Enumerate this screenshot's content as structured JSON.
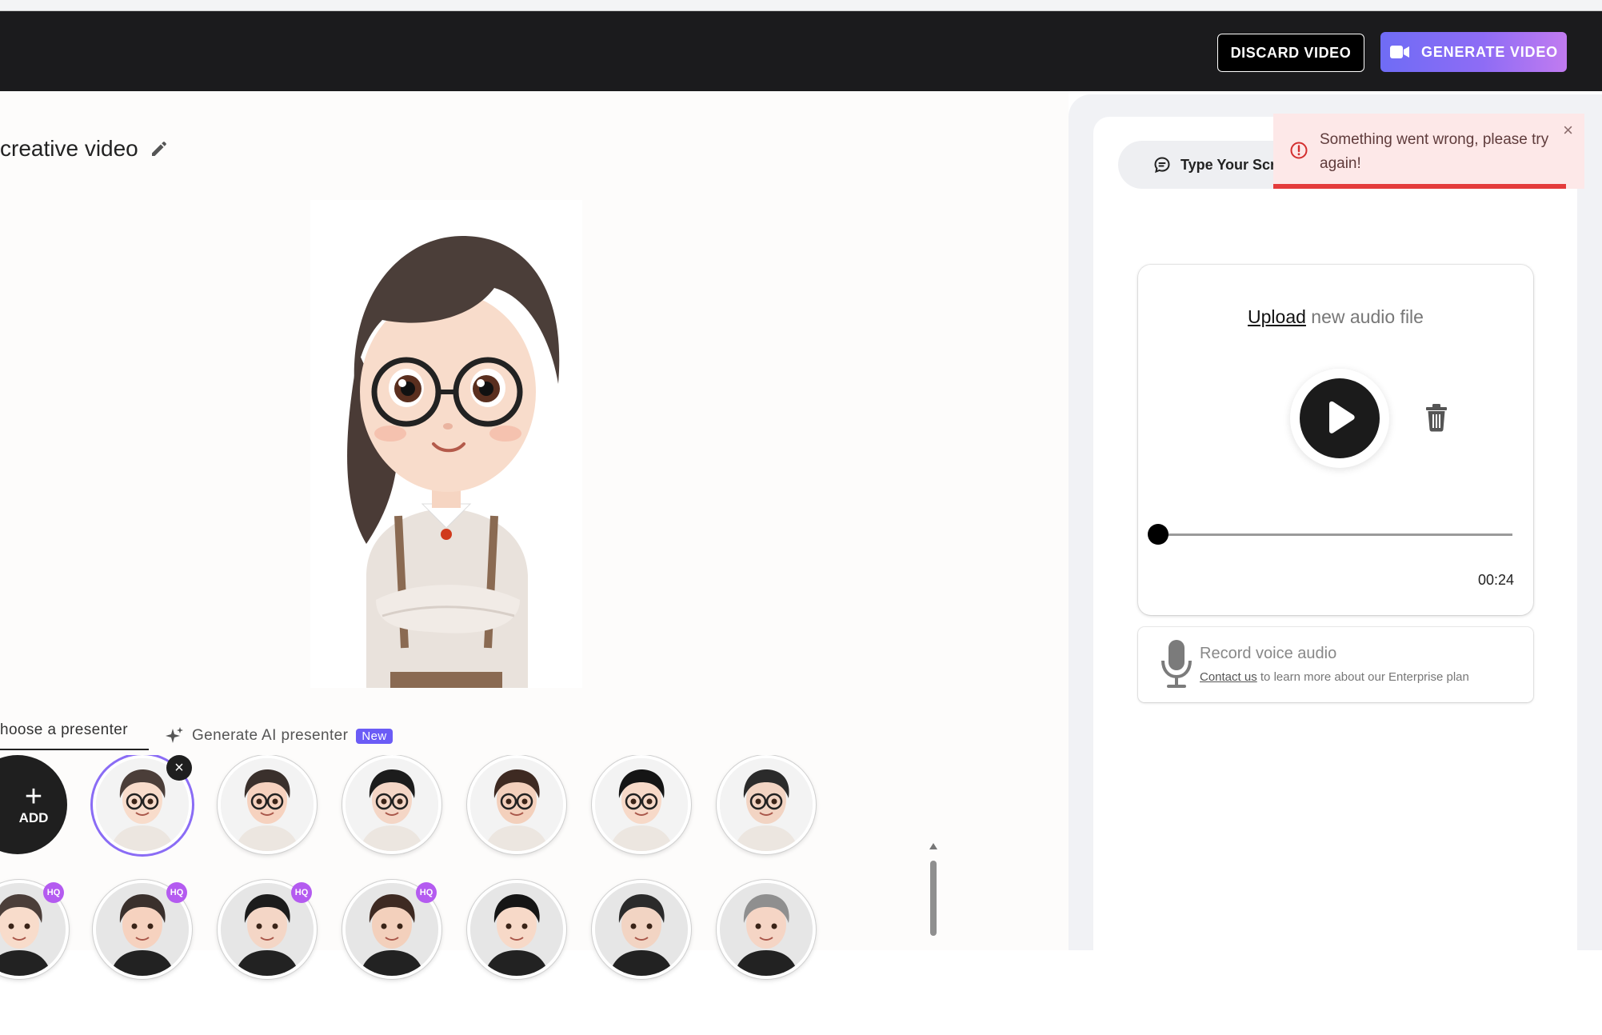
{
  "header": {
    "discard_label": "DISCARD VIDEO",
    "generate_label": "GENERATE VIDEO",
    "generate_gradient": [
      "#6f6cf5",
      "#c17bf0"
    ]
  },
  "project": {
    "title": "creative video"
  },
  "presenter_tabs": {
    "choose_label": "hoose a presenter",
    "generate_label": "Generate AI presenter",
    "new_badge": "New"
  },
  "add_button": {
    "label": "ADD"
  },
  "presenters_row1": [
    {
      "name": "presenter-girl-glasses-selected"
    },
    {
      "name": "presenter-girl-glasses-thinking"
    },
    {
      "name": "presenter-woman-tie"
    },
    {
      "name": "presenter-woman-smile"
    },
    {
      "name": "presenter-woman-glasses-tie"
    },
    {
      "name": "presenter-woman-bun-glasses"
    }
  ],
  "presenters_row2": [
    {
      "name": "presenter-man-suit",
      "badge": "HQ"
    },
    {
      "name": "presenter-woman-curly",
      "badge": "HQ"
    },
    {
      "name": "presenter-man-black-suit",
      "badge": "HQ"
    },
    {
      "name": "presenter-woman-blonde",
      "badge": "HQ"
    },
    {
      "name": "presenter-woman-curly-2",
      "badge": ""
    },
    {
      "name": "presenter-man-beard",
      "badge": ""
    },
    {
      "name": "presenter-woman-gray-hair",
      "badge": ""
    }
  ],
  "right_panel": {
    "script_tab_label": "Type Your Scri",
    "toast": {
      "message": "Something went wrong, please try again!",
      "close": "×",
      "accent": "#e43b3b"
    },
    "audio": {
      "upload_link": "Upload",
      "upload_rest": " new audio file",
      "time": "00:24",
      "progress": 0
    },
    "record": {
      "title": "Record voice audio",
      "contact_link": "Contact us",
      "contact_rest": " to learn more about our Enterprise plan"
    }
  }
}
